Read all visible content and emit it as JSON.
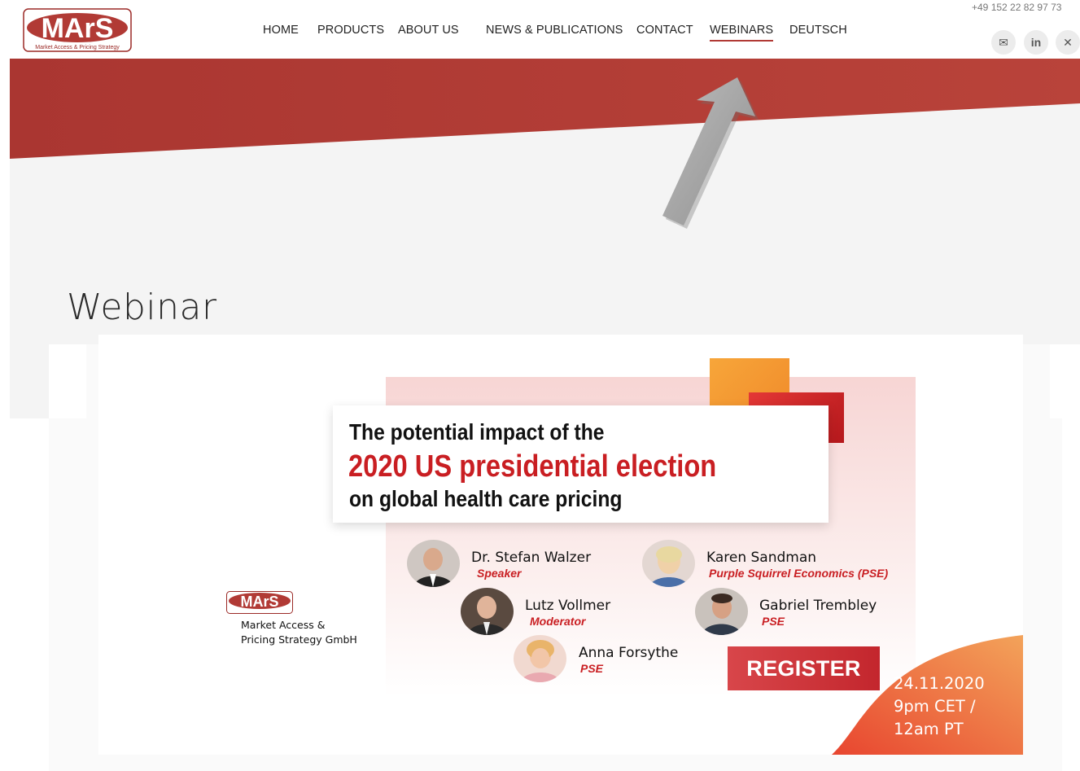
{
  "header": {
    "logo_text": "MArS",
    "logo_subtitle": "Market Access & Pricing Strategy",
    "phone": "+49 152 22 82 97 73",
    "nav": [
      {
        "label": "HOME"
      },
      {
        "label": "PRODUCTS"
      },
      {
        "label": "ABOUT US"
      },
      {
        "label": "NEWS & PUBLICATIONS"
      },
      {
        "label": "CONTACT"
      },
      {
        "label": "WEBINARS",
        "active": true
      },
      {
        "label": "DEUTSCH"
      }
    ],
    "social": [
      {
        "icon": "envelope-icon",
        "glyph": "✉"
      },
      {
        "icon": "linkedin-icon",
        "glyph": "in"
      },
      {
        "icon": "xing-icon",
        "glyph": "✕"
      }
    ]
  },
  "page": {
    "title": "Webinar"
  },
  "webinar": {
    "headline_line1": "The potential impact of the",
    "headline_line2": "2020 US presidential election",
    "headline_line3": "on global health care pricing",
    "company_line1": "Market Access &",
    "company_line2": "Pricing Strategy GmbH",
    "register_label": "REGISTER",
    "date": "24.11.2020",
    "time_line1": "9pm CET /",
    "time_line2": "12am PT",
    "people": [
      {
        "name": "Dr. Stefan Walzer",
        "role": "Speaker"
      },
      {
        "name": "Karen Sandman",
        "role": "Purple Squirrel Economics (PSE)"
      },
      {
        "name": "Lutz Vollmer",
        "role": "Moderator"
      },
      {
        "name": "Gabriel Trembley",
        "role": "PSE"
      },
      {
        "name": "Anna Forsythe",
        "role": "PSE"
      }
    ]
  },
  "colors": {
    "brand_red": "#b13a35",
    "headline_red": "#c91e22",
    "date_orange": "#ee6a3a"
  }
}
